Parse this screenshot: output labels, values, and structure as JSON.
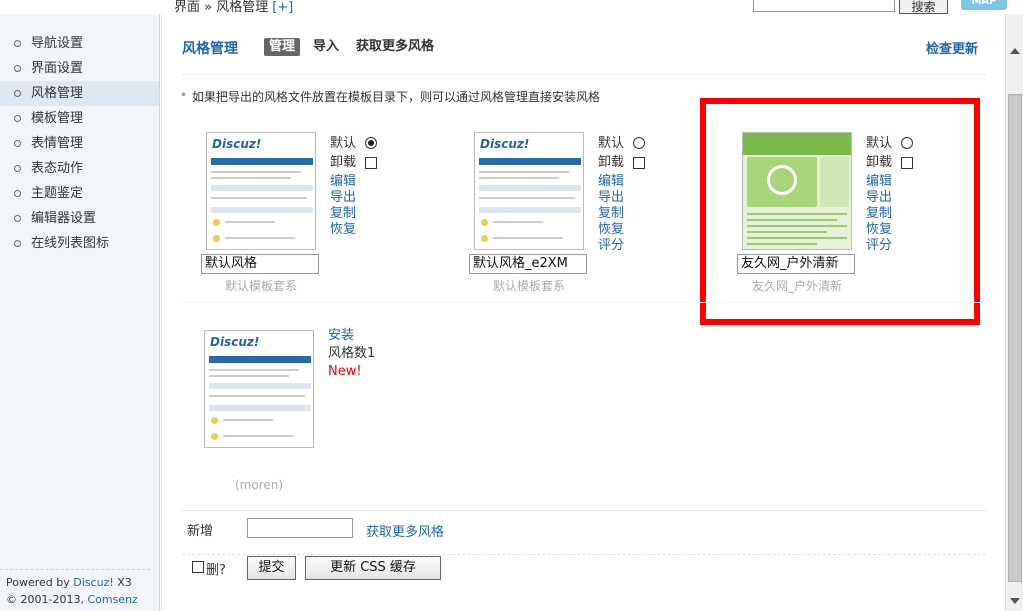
{
  "topbar": {
    "breadcrumb": "界面 » 风格管理",
    "add_link": "[+]",
    "search_button": "搜索",
    "map_button": "MAP"
  },
  "sidebar": {
    "items": [
      {
        "label": "导航设置"
      },
      {
        "label": "界面设置"
      },
      {
        "label": "风格管理"
      },
      {
        "label": "模板管理"
      },
      {
        "label": "表情管理"
      },
      {
        "label": "表态动作"
      },
      {
        "label": "主题鉴定"
      },
      {
        "label": "编辑器设置"
      },
      {
        "label": "在线列表图标"
      }
    ],
    "active_index": 2,
    "footer_line1_prefix": "Powered by ",
    "footer_brand": "Discuz!",
    "footer_version": " X3",
    "footer_line2_prefix": "© 2001-2013, ",
    "footer_company": "Comsenz Inc."
  },
  "header": {
    "title": "风格管理",
    "tab_active": "管理",
    "tab_import": "导入",
    "tab_more": "获取更多风格",
    "check_update": "检查更新"
  },
  "tip": "如果把导出的风格文件放置在模板目录下，则可以通过风格管理直接安装风格",
  "labels": {
    "default": "默认",
    "uninstall": "卸载",
    "edit": "编辑",
    "export": "导出",
    "copy": "复制",
    "restore": "恢复",
    "rate": "评分",
    "install": "安装",
    "style_count": "风格数1",
    "new": "New!"
  },
  "themes": [
    {
      "name": "默认风格",
      "desc": "默认模板套系",
      "default_selected": true,
      "thumb_logo": "Discuz!"
    },
    {
      "name": "默认风格_e2XM",
      "desc": "默认模板套系",
      "default_selected": false,
      "thumb_logo": "Discuz!"
    },
    {
      "name": "友久网_户外清新",
      "desc": "友久网_户外清新",
      "default_selected": false,
      "thumb_logo": ""
    }
  ],
  "uninstalled": {
    "desc": "(moren)",
    "thumb_logo": "Discuz!"
  },
  "form": {
    "add_label": "新增",
    "add_link": "获取更多风格",
    "delete_label": "删?",
    "submit": "提交",
    "update_css": "更新 CSS 缓存"
  },
  "colors": {
    "accent": "#2366a8",
    "highlight": "#ff0000",
    "new": "#ee0000"
  }
}
